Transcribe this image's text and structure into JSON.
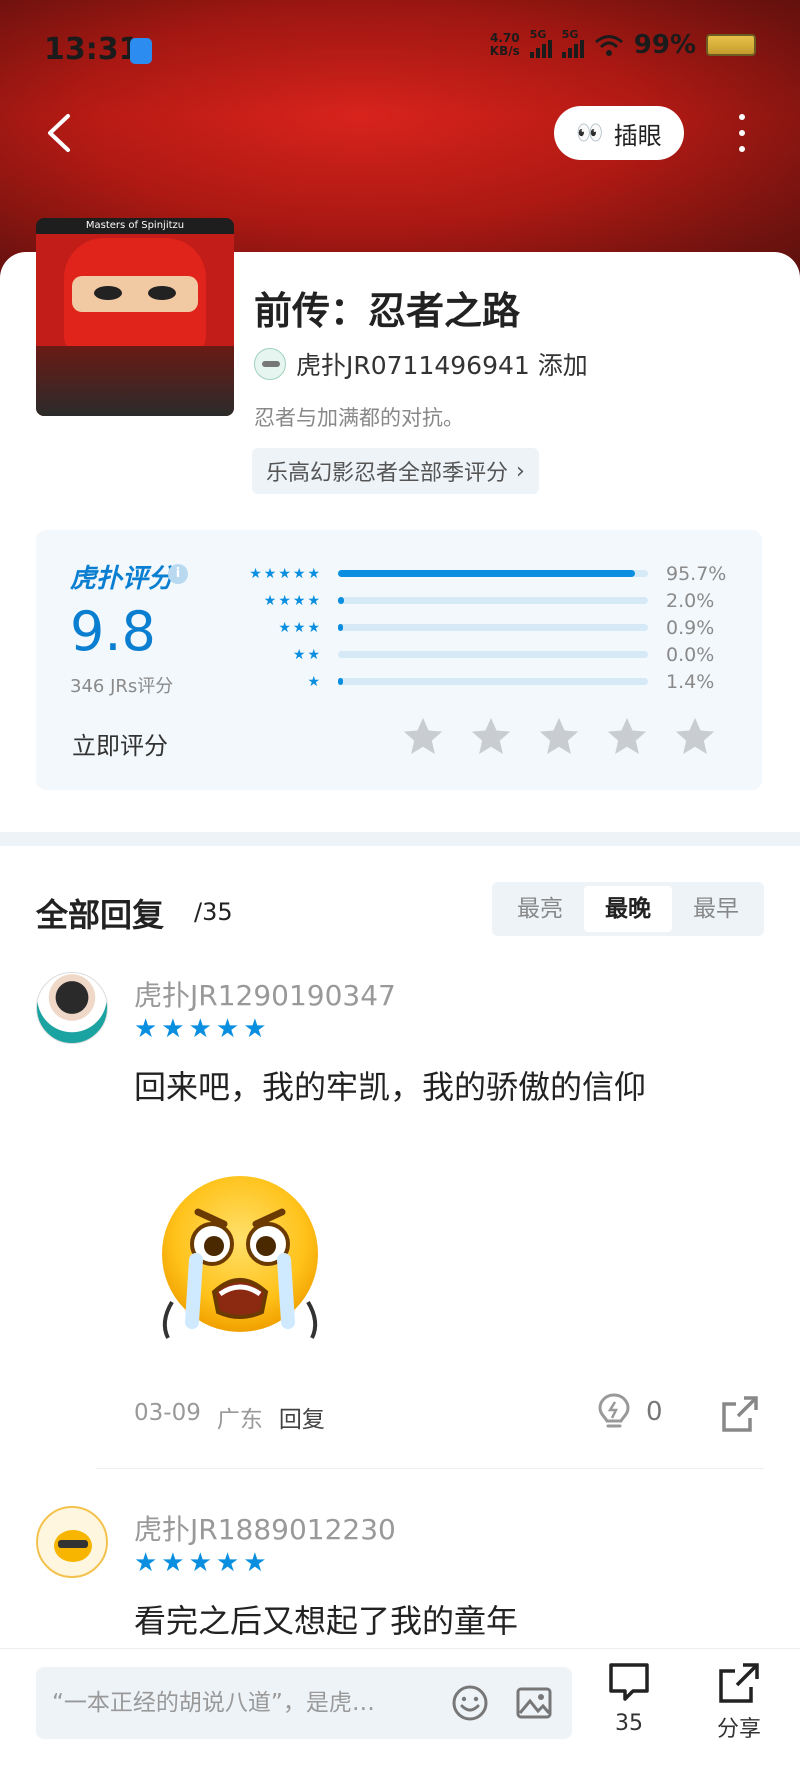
{
  "status_bar": {
    "time": "13:31",
    "net_speed_value": "4.70",
    "net_speed_unit": "KB/s",
    "signal_1_label": "5G",
    "signal_2_label": "5G",
    "battery": "99%"
  },
  "nav": {
    "peek_label": "插眼",
    "peek_eyes": "👀"
  },
  "poster": {
    "strip_text": "Masters of Spinjitzu"
  },
  "show": {
    "title": "前传：忍者之路",
    "creator": "虎扑JR0711496941 添加",
    "description": "忍者与加满都的对抗。",
    "collection": "乐高幻影忍者全部季评分",
    "collection_chevron": "›"
  },
  "rating": {
    "logo": "虎扑评分",
    "logo_mark": "®",
    "info": "i",
    "score": "9.8",
    "count": "346 JRs评分",
    "rate_now": "立即评分",
    "distribution": [
      {
        "stars": "★★★★★",
        "fraction": 0.957,
        "pct": "95.7%"
      },
      {
        "stars": "★★★★",
        "fraction": 0.02,
        "pct": "2.0%"
      },
      {
        "stars": "★★★",
        "fraction": 0.009,
        "pct": "0.9%"
      },
      {
        "stars": "★★",
        "fraction": 0.0,
        "pct": "0.0%"
      },
      {
        "stars": "★",
        "fraction": 0.014,
        "pct": "1.4%"
      }
    ]
  },
  "replies": {
    "title": "全部回复",
    "count": "/35",
    "sort_tabs": [
      "最亮",
      "最晚",
      "最早"
    ],
    "active_sort": "最晚",
    "items": [
      {
        "user": "虎扑JR1290190347",
        "stars": "★★★★★",
        "text": "回来吧，我的牢凯，我的骄傲的信仰",
        "date": "03-09",
        "region": "广东",
        "reply_label": "回复",
        "likes": "0"
      },
      {
        "user": "虎扑JR1889012230",
        "stars": "★★★★★",
        "text": "看完之后又想起了我的童年"
      }
    ]
  },
  "bottom_bar": {
    "input_placeholder": "“一本正经的胡说八道”，是虎…",
    "comment_count": "35",
    "share_label": "分享"
  },
  "colors": {
    "accent": "#0a8fe0",
    "hero_red": "#c21d18"
  }
}
